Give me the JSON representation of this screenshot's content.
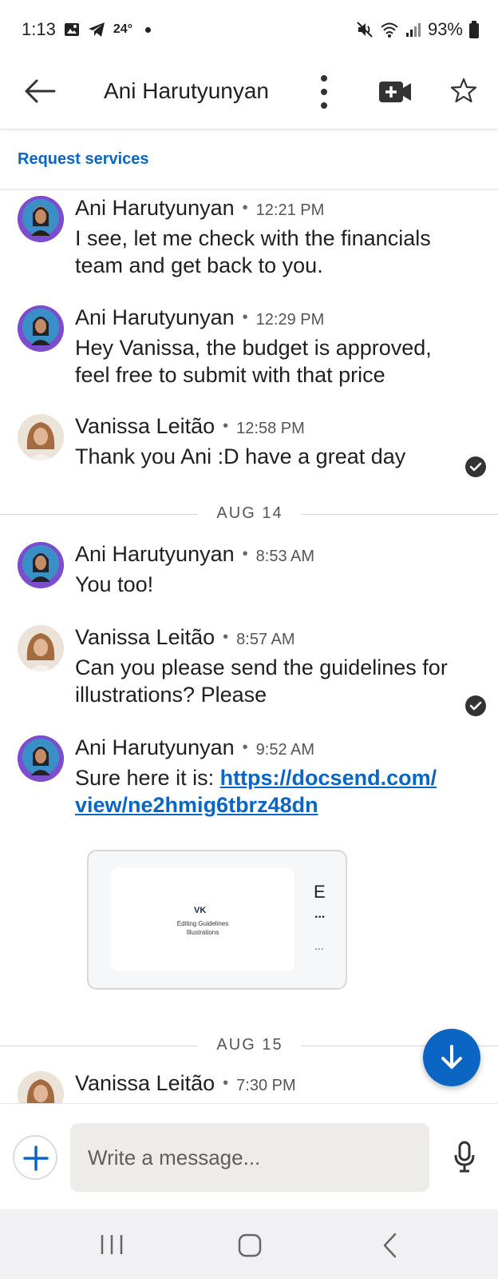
{
  "status_bar": {
    "time": "1:13",
    "temperature": "24°",
    "battery": "93%"
  },
  "header": {
    "title": "Ani Harutyunyan"
  },
  "request_services": "Request services",
  "messages": [
    {
      "sender": "Ani Harutyunyan",
      "time": "12:21 PM",
      "text": "I see, let me check with the financials team and get back to you."
    },
    {
      "sender": "Ani Harutyunyan",
      "time": "12:29 PM",
      "text": "Hey Vanissa, the budget is approved, feel free to submit with that price"
    },
    {
      "sender": "Vanissa Leitão",
      "time": "12:58 PM",
      "text": "Thank you Ani :D have a great day"
    },
    {
      "sender": "Ani Harutyunyan",
      "time": "8:53 AM",
      "text": "You too!"
    },
    {
      "sender": "Vanissa Leitão",
      "time": "8:57 AM",
      "text": "Can you please send the guidelines for illustrations? Please"
    },
    {
      "sender": "Ani Harutyunyan",
      "time": "9:52 AM",
      "text_prefix": "Sure here it is: ",
      "link": "https://docsend.com/view/ne2hmig6tbrz48dn",
      "link_line1": "https://docsend.com/",
      "link_line2": "view/ne2hmig6tbrz48dn"
    },
    {
      "sender": "Vanissa Leitão",
      "time": "7:30 PM"
    }
  ],
  "date_dividers": [
    "AUG 14",
    "AUG 15"
  ],
  "link_preview": {
    "logo": "VK",
    "thumb_line1": "Editing Guidelines",
    "thumb_line2": "Illustrations",
    "title": "E",
    "dots1": "...",
    "dots2": "..."
  },
  "composer": {
    "placeholder": "Write a message..."
  },
  "colors": {
    "accent": "#0a66c2",
    "hiring_ring": "#7c4dcc"
  }
}
